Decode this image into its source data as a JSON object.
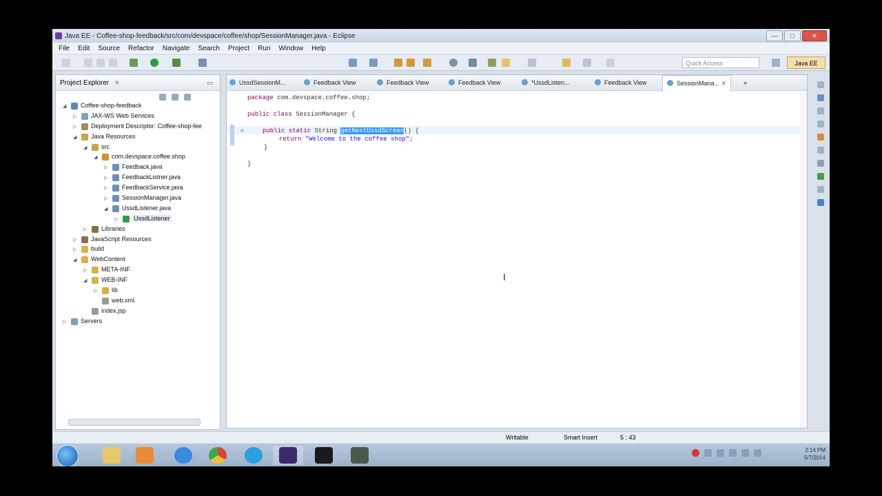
{
  "window": {
    "title": "Java EE - Coffee-shop-feedback/src/com/devspace/coffee/shop/SessionManager.java - Eclipse",
    "minimize": "—",
    "maximize": "□",
    "close": "✕"
  },
  "menu": [
    "File",
    "Edit",
    "Source",
    "Refactor",
    "Navigate",
    "Search",
    "Project",
    "Run",
    "Window",
    "Help"
  ],
  "toolbar": {
    "quick_access_placeholder": "Quick Access",
    "perspective": "Java EE"
  },
  "project_explorer": {
    "title": "Project Explorer",
    "tree": [
      {
        "label": "Coffee-shop-feedback",
        "level": 0,
        "arrow": "◢",
        "color": "#5b87b8"
      },
      {
        "label": "JAX-WS Web Services",
        "level": 1,
        "arrow": "▷",
        "color": "#7f9fbf"
      },
      {
        "label": "Deployment Descriptor: Coffee-shop-fee",
        "level": 1,
        "arrow": "▷",
        "color": "#a08a60"
      },
      {
        "label": "Java Resources",
        "level": 1,
        "arrow": "◢",
        "color": "#c9a24a"
      },
      {
        "label": "src",
        "level": 2,
        "arrow": "◢",
        "color": "#c9a24a"
      },
      {
        "label": "com.devspace.coffee.shop",
        "level": 3,
        "arrow": "◢",
        "color": "#d1902f"
      },
      {
        "label": "Feedback.java",
        "level": 4,
        "arrow": "▷",
        "color": "#6d8fb5"
      },
      {
        "label": "FeedbackListner.java",
        "level": 4,
        "arrow": "▷",
        "color": "#6d8fb5"
      },
      {
        "label": "FeedbackService.java",
        "level": 4,
        "arrow": "▷",
        "color": "#6d8fb5"
      },
      {
        "label": "SessionManager.java",
        "level": 4,
        "arrow": "▷",
        "color": "#6d8fb5"
      },
      {
        "label": "UssdListener.java",
        "level": 4,
        "arrow": "◢",
        "color": "#6d8fb5"
      },
      {
        "label": "UssdListener",
        "level": 5,
        "arrow": "▷",
        "color": "#3a9a4a",
        "selected": true
      },
      {
        "label": "Libraries",
        "level": 2,
        "arrow": "▷",
        "color": "#8b6f4a"
      },
      {
        "label": "JavaScript Resources",
        "level": 1,
        "arrow": "▷",
        "color": "#8b6f4a"
      },
      {
        "label": "build",
        "level": 1,
        "arrow": "▷",
        "color": "#d9b14a"
      },
      {
        "label": "WebContent",
        "level": 1,
        "arrow": "◢",
        "color": "#d9b14a"
      },
      {
        "label": "META-INF",
        "level": 2,
        "arrow": "▷",
        "color": "#d9b14a"
      },
      {
        "label": "WEB-INF",
        "level": 2,
        "arrow": "◢",
        "color": "#d9b14a"
      },
      {
        "label": "lib",
        "level": 3,
        "arrow": "▷",
        "color": "#d9b14a"
      },
      {
        "label": "web.xml",
        "level": 3,
        "arrow": "",
        "color": "#9a9a9a"
      },
      {
        "label": "index.jsp",
        "level": 2,
        "arrow": "",
        "color": "#9a9a9a"
      },
      {
        "label": "Servers",
        "level": 0,
        "arrow": "▷",
        "color": "#7f9fbf"
      }
    ]
  },
  "editor": {
    "tabs": [
      {
        "label": "UssdSessionM..."
      },
      {
        "label": "Feedback View"
      },
      {
        "label": "Feedback View"
      },
      {
        "label": "Feedback View"
      },
      {
        "label": "*UssdListen..."
      },
      {
        "label": "Feedback View"
      },
      {
        "label": "SessionMana...",
        "active": true
      }
    ],
    "overflow": "»",
    "code": {
      "package_kw": "package",
      "package_name": " com.devspace.coffee.shop;",
      "class_kw": "public class",
      "class_name": " SessionManager {",
      "method_kw": "public static",
      "method_type": " String ",
      "method_name": "getNextUssdScreen",
      "method_tail": "() {",
      "return_kw": "return",
      "return_str": " \"Welcome to the coffee shop\"",
      "return_end": ";",
      "close1": "}",
      "close2": "}"
    }
  },
  "status": {
    "writable": "Writable",
    "insert_mode": "Smart Insert",
    "position": "5 : 43"
  },
  "taskbar": {
    "time": "2:14 PM",
    "date": "5/7/2014"
  }
}
